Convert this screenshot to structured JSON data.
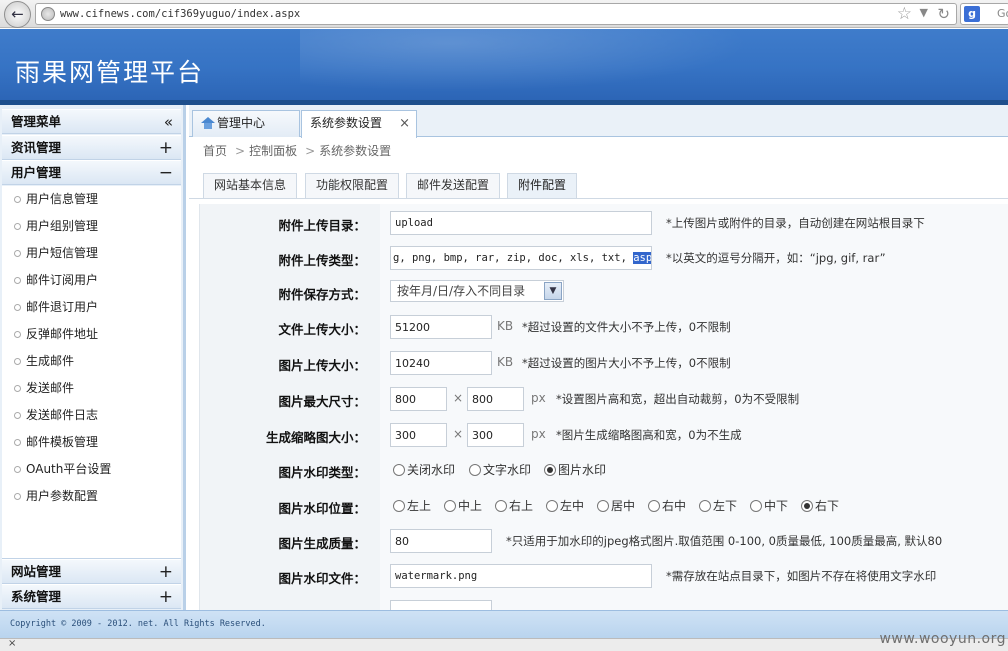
{
  "browser": {
    "url": "www.cifnews.com/cif369yuguo/index.aspx",
    "search_brand": "g",
    "search_placeholder": "Go"
  },
  "header": {
    "title": "雨果网管理平台"
  },
  "sidebar": {
    "title": "管理菜单",
    "collapse_icon": "double-chevron-left-icon",
    "sections": [
      {
        "label": "资讯管理",
        "sign": "+"
      },
      {
        "label": "用户管理",
        "sign": "−"
      }
    ],
    "items": [
      "用户信息管理",
      "用户组别管理",
      "用户短信管理",
      "邮件订阅用户",
      "邮件退订用户",
      "反弹邮件地址",
      "生成邮件",
      "发送邮件",
      "发送邮件日志",
      "邮件模板管理",
      "OAuth平台设置",
      "用户参数配置"
    ],
    "bottom_sections": [
      {
        "label": "网站管理",
        "sign": "+"
      },
      {
        "label": "系统管理",
        "sign": "+"
      }
    ]
  },
  "tabs": [
    {
      "label": "管理中心"
    },
    {
      "label": "系统参数设置",
      "close": "×"
    }
  ],
  "breadcrumb": [
    "首页",
    "控制面板",
    "系统参数设置"
  ],
  "breadcrumb_sep": ">",
  "subtabs": [
    "网站基本信息",
    "功能权限配置",
    "邮件发送配置",
    "附件配置"
  ],
  "form": {
    "upload_dir": {
      "label": "附件上传目录：",
      "value": "upload",
      "hint": "*上传图片或附件的目录，自动创建在网站根目录下"
    },
    "upload_types": {
      "label": "附件上传类型：",
      "value": "g, png, bmp, rar, zip, doc, xls, txt, ",
      "value_selected": "aspx, ashx, asp",
      "hint": "*以英文的逗号分隔开，如：“jpg, gif, rar”"
    },
    "save_mode": {
      "label": "附件保存方式：",
      "value": "按年月/日/存入不同目录"
    },
    "file_size": {
      "label": "文件上传大小：",
      "value": "51200",
      "unit": "KB",
      "hint": "*超过设置的文件大小不予上传，0不限制"
    },
    "image_size": {
      "label": "图片上传大小：",
      "value": "10240",
      "unit": "KB",
      "hint": "*超过设置的图片大小不予上传，0不限制"
    },
    "max_dim": {
      "label": "图片最大尺寸：",
      "w": "800",
      "h": "800",
      "x": "×",
      "unit": "px",
      "hint": "*设置图片高和宽，超出自动裁剪，0为不受限制"
    },
    "thumb_dim": {
      "label": "生成缩略图大小：",
      "w": "300",
      "h": "300",
      "x": "×",
      "unit": "px",
      "hint": "*图片生成缩略图高和宽，0为不生成"
    },
    "wm_type": {
      "label": "图片水印类型：",
      "options": [
        "关闭水印",
        "文字水印",
        "图片水印"
      ],
      "selected": "图片水印"
    },
    "wm_pos": {
      "label": "图片水印位置：",
      "options": [
        "左上",
        "中上",
        "右上",
        "左中",
        "居中",
        "右中",
        "左下",
        "中下",
        "右下"
      ],
      "selected": "右下"
    },
    "quality": {
      "label": "图片生成质量：",
      "value": "80",
      "hint": "*只适用于加水印的jpeg格式图片.取值范围 0-100, 0质量最低, 100质量最高, 默认80"
    },
    "wm_file": {
      "label": "图片水印文件：",
      "value": "watermark.png",
      "hint": "*需存放在站点目录下，如图片不存在将使用文字水印"
    }
  },
  "footer": {
    "copyright": "Copyright © 2009 - 2012. net. All Rights Reserved."
  },
  "watermark": "www.wooyun.org",
  "statusbar": {
    "close": "×"
  }
}
